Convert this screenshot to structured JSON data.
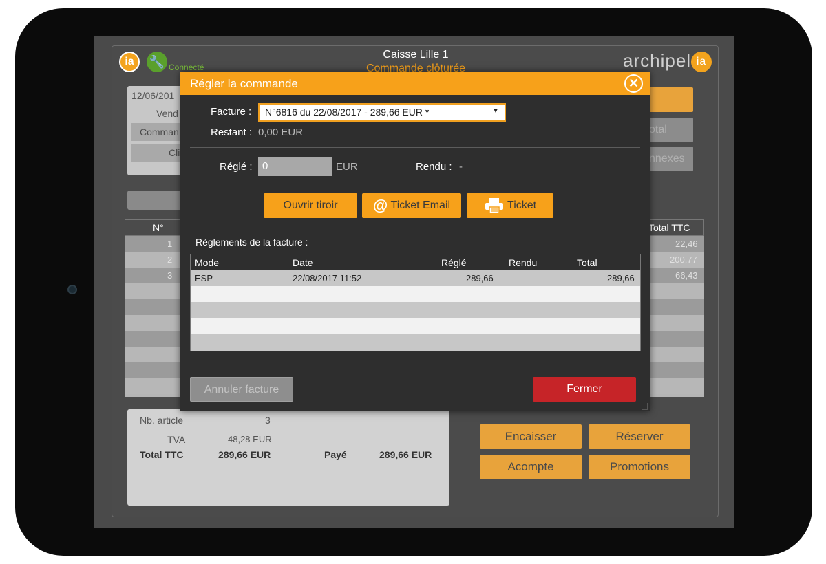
{
  "header": {
    "register_name": "Caisse Lille 1",
    "order_status": "Commande clôturée",
    "connection_status": "Connecté",
    "brand": "archipel",
    "brand_suffix": "ia",
    "logo_text": "ia"
  },
  "order_info": {
    "date_partial": "12/06/201",
    "vendor_partial": "Vend",
    "order_partial": "Comman",
    "client_partial": "Cli"
  },
  "right_buttons": {
    "total_partial": "otal",
    "annexes_partial": "nnexes"
  },
  "bg_table": {
    "col_num": "N°",
    "col_total": "Total TTC",
    "rows": [
      {
        "num": "1",
        "total": "22,46"
      },
      {
        "num": "2",
        "total": "200,77"
      },
      {
        "num": "3",
        "total": "66,43"
      }
    ]
  },
  "summary": {
    "nb_article_label": "Nb. article",
    "nb_article_value": "3",
    "tva_label": "TVA",
    "tva_value": "48,28 EUR",
    "total_ttc_label": "Total TTC",
    "total_ttc_value": "289,66 EUR",
    "paid_label": "Payé",
    "paid_value": "289,66 EUR"
  },
  "bottom_actions": {
    "encaisser": "Encaisser",
    "reserver": "Réserver",
    "acompte": "Acompte",
    "promotions": "Promotions"
  },
  "modal": {
    "title": "Régler la commande",
    "facture_label": "Facture :",
    "facture_value": "N°6816 du 22/08/2017 - 289,66 EUR *",
    "restant_label": "Restant :",
    "restant_value": "0,00 EUR",
    "regle_label": "Réglé :",
    "regle_value": "0",
    "regle_unit": "EUR",
    "rendu_label": "Rendu :",
    "rendu_value": "-",
    "open_drawer": "Ouvrir tiroir",
    "ticket_email": "Ticket Email",
    "ticket": "Ticket",
    "payments_title": "Règlements de la facture :",
    "payments_columns": {
      "mode": "Mode",
      "date": "Date",
      "regle": "Réglé",
      "rendu": "Rendu",
      "total": "Total"
    },
    "payments": [
      {
        "mode": "ESP",
        "date": "22/08/2017 11:52",
        "regle": "289,66",
        "rendu": "",
        "total": "289,66"
      }
    ],
    "cancel_invoice": "Annuler facture",
    "close": "Fermer"
  },
  "colors": {
    "accent_orange": "#f7a11a",
    "danger_red": "#c62428",
    "connected_green": "#5aa02c"
  },
  "icons": {
    "logo": "ia-logo-icon",
    "wrench": "wrench-icon",
    "close": "close-circle-icon",
    "at": "at-icon",
    "printer": "printer-icon",
    "dropdown": "chevron-down-icon"
  }
}
